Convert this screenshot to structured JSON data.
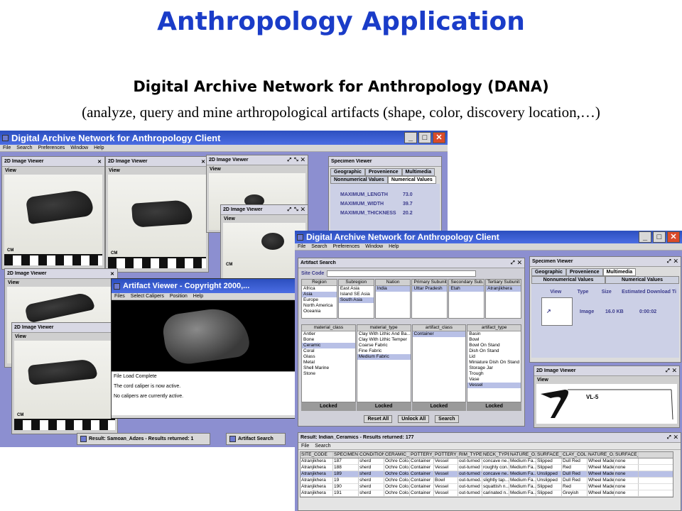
{
  "slide": {
    "title": "Anthropology Application",
    "subtitle": "Digital Archive Network for Anthropology (DANA)",
    "description": "(analyze, query and mine arthropological artifacts (shape, color, discovery location,…)"
  },
  "app1": {
    "title": "Digital Archive Network for Anthropology Client",
    "menu": [
      "File",
      "Search",
      "Preferences",
      "Window",
      "Help"
    ]
  },
  "viewers": {
    "title": "2D Image Viewer",
    "view": "View",
    "cm": "CM",
    "controls": "⤢ ⤡ ✕"
  },
  "specimen1": {
    "title": "Specimen Viewer",
    "tabs": [
      "Geographic",
      "Provenience",
      "Multimedia"
    ],
    "subtabs": [
      "Nonnumerical Values",
      "Numerical Values"
    ],
    "values": [
      {
        "k": "MAXIMUM_LENGTH",
        "v": "73.0"
      },
      {
        "k": "MAXIMUM_WIDTH",
        "v": "39.7"
      },
      {
        "k": "MAXIMUM_THICKNESS",
        "v": "20.2"
      }
    ]
  },
  "artifact_viewer": {
    "title": "Artifact Viewer - Copyright 2000,...",
    "menu": [
      "Files",
      "Select Calipers",
      "Position",
      "Help"
    ],
    "log": [
      "File Load Complete",
      "The cord caliper is now active.",
      "No calipers are currently active."
    ]
  },
  "taskbar1": {
    "result": "Result: Samoan_Adzes - Results returned: 1",
    "search": "Artifact Search"
  },
  "app2": {
    "title": "Digital Archive Network for Anthropology Client",
    "menu": [
      "File",
      "Search",
      "Preferences",
      "Window",
      "Help"
    ]
  },
  "artifact_search": {
    "title": "Artifact Search",
    "site_code": "Site Code",
    "geo_lists": [
      {
        "head": "Region",
        "items": [
          "Africa",
          "Asia",
          "Europe",
          "North America",
          "Oceania"
        ],
        "sel": 1
      },
      {
        "head": "Subregion",
        "items": [
          "East Asia",
          "Island SE Asia",
          "South Asia"
        ],
        "sel": 2
      },
      {
        "head": "Nation",
        "items": [
          "India"
        ],
        "sel": 0
      },
      {
        "head": "Primary Subunit",
        "items": [
          "Uttar Pradesh"
        ],
        "sel": 0
      },
      {
        "head": "Secondary Sub...",
        "items": [
          "Etah"
        ],
        "sel": 0
      },
      {
        "head": "Tertiary Subunit",
        "items": [
          "Atranjikhera"
        ],
        "sel": 0
      }
    ],
    "class_lists": [
      {
        "head": "material_class",
        "items": [
          "Antler",
          "Bone",
          "Ceramic",
          "Coral",
          "Glass",
          "Metal",
          "Shell Marine",
          "Stone"
        ],
        "sel": 2
      },
      {
        "head": "material_type",
        "items": [
          "Clay With Lithic And Ba...",
          "Clay With Lithic Temper",
          "Coarse Fabric",
          "Fine Fabric",
          "Medium Fabric"
        ],
        "sel": 4
      },
      {
        "head": "artifact_class",
        "items": [
          "Container"
        ],
        "sel": 0
      },
      {
        "head": "artifact_type",
        "items": [
          "Basin",
          "Bowl",
          "Bowl On Stand",
          "Dish On Stand",
          "Lid",
          "Miniature Dish On Stand",
          "Storage Jar",
          "Trough",
          "Vase",
          "Vessel"
        ],
        "sel": 9
      }
    ],
    "locked": "Locked",
    "buttons": [
      "Reset All",
      "Unlock All",
      "Search"
    ]
  },
  "specimen2": {
    "title": "Specimen Viewer",
    "tabs": [
      "Geographic",
      "Provenience",
      "Multimedia"
    ],
    "subtabs": [
      "Nonnumerical Values",
      "Numerical Values"
    ],
    "cols": [
      "View",
      "Type",
      "Size",
      "Estimated Download Ti"
    ],
    "row": {
      "type": "Image",
      "size": "16.0 KB",
      "time": "0:00:02"
    }
  },
  "viewer2": {
    "title": "2D Image Viewer",
    "view": "View",
    "label": "VL-5"
  },
  "results": {
    "title": "Result: Indian_Ceramics - Results returned: 177",
    "menu": [
      "File",
      "Search"
    ],
    "cols": [
      "SITE_CODE",
      "SPECIMEN...",
      "CONDITION",
      "CERAMIC_...",
      "POTTERY_...",
      "POTTERY_...",
      "RIM_TYPE",
      "NECK_TYPE",
      "NATURE_O...",
      "SURFACE_...",
      "CLAY_COL...",
      "NATURE_O...",
      "SURFACE_..."
    ],
    "rows": [
      [
        "Atranjikhera",
        "187",
        "sherd",
        "Ochre Colo...",
        "Container",
        "Vessel",
        "out-turned f...",
        "concave ne...",
        "Medium Fa...",
        "Slipped",
        "Dull Red",
        "Wheel Made",
        "none"
      ],
      [
        "Atranjikhera",
        "188",
        "sherd",
        "Ochre Colo...",
        "Container",
        "Vessel",
        "out-turned f...",
        "roughly con...",
        "Medium Fa...",
        "Slipped",
        "Red",
        "Wheel Made",
        "none"
      ],
      [
        "Atranjikhera",
        "189",
        "sherd",
        "Ochre Colo...",
        "Container",
        "Vessel",
        "out-turned f...",
        "concave ne...",
        "Medium Fa...",
        "Unslipped",
        "Dull Red",
        "Wheel Made",
        "none"
      ],
      [
        "Atranjikhera",
        "19",
        "sherd",
        "Ochre Colo...",
        "Container",
        "Bowl",
        "out-turned...",
        "slightly tap...",
        "Medium Fa...",
        "Unslipped",
        "Dull Red",
        "Wheel Made",
        "none"
      ],
      [
        "Atranjikhera",
        "190",
        "sherd",
        "Ochre Colo...",
        "Container",
        "Vessel",
        "out-turned f...",
        "squattish n...",
        "Medium Fa...",
        "Slipped",
        "Red",
        "Wheel Made",
        "none"
      ],
      [
        "Atranjikhera",
        "191",
        "sherd",
        "Ochre Colo...",
        "Container",
        "Vessel",
        "out-turned f...",
        "carinated n...",
        "Medium Fa...",
        "Slipped",
        "Greyish",
        "Wheel Made",
        "none"
      ]
    ],
    "selected_row": 2
  },
  "colors": {
    "title_blue": "#1a3cc8",
    "desktop": "#8c8fd0",
    "titlebar": "#2c4fbf"
  }
}
